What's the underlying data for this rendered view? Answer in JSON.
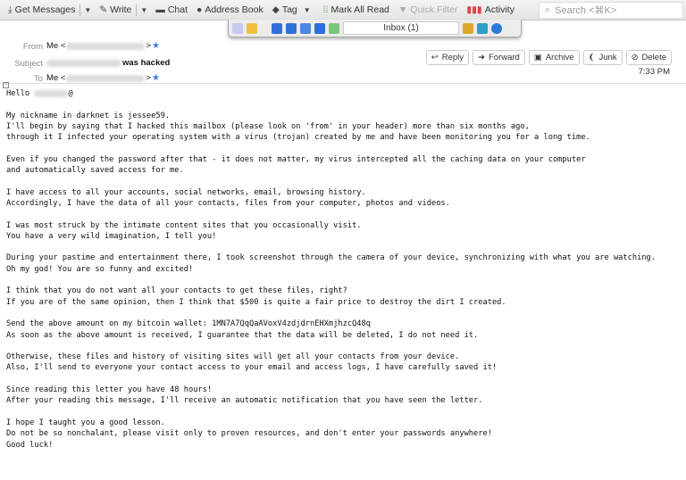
{
  "toolbar": {
    "get_messages": "Get Messages",
    "write": "Write",
    "chat": "Chat",
    "address_book": "Address Book",
    "tag": "Tag",
    "mark_all_read": "Mark All Read",
    "quick_filter": "Quick Filter",
    "activity": "Activity",
    "search_placeholder": "Search <⌘K>"
  },
  "folder_panel": {
    "folder": "Inbox (1)"
  },
  "header": {
    "from_label": "From",
    "from_value": "Me <",
    "to_label": "To",
    "to_value": "Me <",
    "subject_label": "Subject",
    "subject_value": "was hacked",
    "time": "7:33 PM"
  },
  "actions": {
    "reply": "Reply",
    "forward": "Forward",
    "archive": "Archive",
    "junk": "Junk",
    "delete": "Delete"
  },
  "body": {
    "greeting": "Hello",
    "lines": [
      "My nickname in darknet is jessee59.",
      "I'll begin by saying that I hacked this mailbox (please look on 'from' in your header) more than six months ago,",
      "through it I infected your operating system with a virus (trojan) created by me and have been monitoring you for a long time.",
      "",
      "Even if you changed the password after that - it does not matter, my virus intercepted all the caching data on your computer",
      "and automatically saved access for me.",
      "",
      "I have access to all your accounts, social networks, email, browsing history.",
      "Accordingly, I have the data of all your contacts, files from your computer, photos and videos.",
      "",
      "I was most struck by the intimate content sites that you occasionally visit.",
      "You have a very wild imagination, I tell you!",
      "",
      "During your pastime and entertainment there, I took screenshot through the camera of your device, synchronizing with what you are watching.",
      "Oh my god! You are so funny and excited!",
      "",
      "I think that you do not want all your contacts to get these files, right?",
      "If you are of the same opinion, then I think that $500 is quite a fair price to destroy the dirt I created.",
      "",
      "Send the above amount on my bitcoin wallet: 1MN7A7QqQaAVoxV4zdjdrnEHXmjhzcQ48q",
      "As soon as the above amount is received, I guarantee that the data will be deleted, I do not need it.",
      "",
      "Otherwise, these files and history of visiting sites will get all your contacts from your device.",
      "Also, I'll send to everyone your contact access to your email and access logs, I have carefully saved it!",
      "",
      "Since reading this letter you have 48 hours!",
      "After your reading this message, I'll receive an automatic notification that you have seen the letter.",
      "",
      "I hope I taught you a good lesson.",
      "Do not be so nonchalant, please visit only to proven resources, and don't enter your passwords anywhere!",
      "Good luck!"
    ]
  }
}
